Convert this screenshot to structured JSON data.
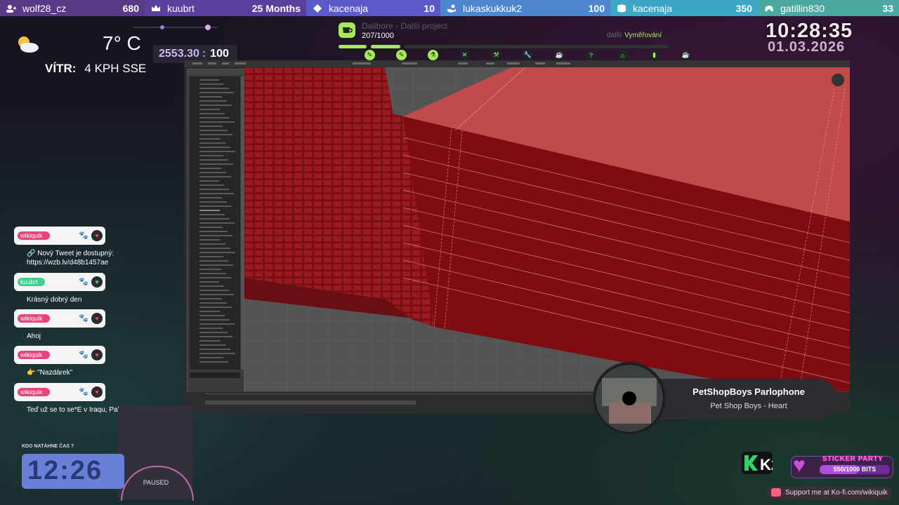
{
  "top_bar": [
    {
      "icon": "user-plus-icon",
      "name": "wolf28_cz",
      "value": "680",
      "bg": "#5a3a86"
    },
    {
      "icon": "crown-icon",
      "name": "kuubrt",
      "value": "25 Months",
      "bg": "#5b3f9e"
    },
    {
      "icon": "diamond-icon",
      "name": "kacenaja",
      "value": "10",
      "bg": "#5c5ac8"
    },
    {
      "icon": "hand-icon",
      "name": "lukaskukkuk2",
      "value": "100",
      "bg": "#4d86cf"
    },
    {
      "icon": "coins-icon",
      "name": "kacenaja",
      "value": "350",
      "bg": "#3da6c7"
    },
    {
      "icon": "gamepad-icon",
      "name": "gatillin830",
      "value": "33",
      "bg": "#4ca8a0"
    }
  ],
  "weather": {
    "icon": "partly-cloudy-icon",
    "temperature": "7° C",
    "wind_label": "VÍTR:",
    "wind_value": "4 KPH SSE"
  },
  "counter": {
    "value": "2553.30",
    "separator": ":",
    "max": "100"
  },
  "clock": {
    "time": "10:28:35",
    "date": "01.03.2026"
  },
  "goal": {
    "title": "Dalibore - Další project",
    "count": "207/1000",
    "progress": 0.207,
    "next_label": "další",
    "next_value": "Vyměřování",
    "colors": {
      "accent": "#a8e85c"
    },
    "milestones": [
      "pencil-icon",
      "pencil-icon",
      "flask-icon",
      "close-icon",
      "hammer-icon",
      "wrench-icon",
      "cup-icon",
      "help-icon",
      "home-icon",
      "bookmark-icon",
      "cup-icon"
    ]
  },
  "chat": [
    {
      "user": "wikiquik",
      "tag_color": "#e8437b",
      "badge": "paw-icon",
      "lines": [
        "🔗 Nový Tweet je dostupný:",
        "https://wzb.lv/d48b1457ae"
      ]
    },
    {
      "user": "kuubrt",
      "tag_color": "#3fcf8e",
      "badge": "paw-icon",
      "lines": [
        "Krásný dobrý den"
      ]
    },
    {
      "user": "wikiquik",
      "tag_color": "#e8437b",
      "badge": "paw-icon",
      "lines": [
        "Ahoj"
      ]
    },
    {
      "user": "wikiquik",
      "tag_color": "#e8437b",
      "badge": "paw-icon",
      "lines": [
        "👉 \"Nazdárek\""
      ]
    },
    {
      "user": "wikiquik",
      "tag_color": "#e8437b",
      "badge": "paw-icon",
      "lines": [
        "Teď už se to se*E v Iraqu, Pakistanu"
      ]
    }
  ],
  "bottom_left": {
    "kdo_label": "KDO NATÁHNE ČAS ?",
    "kdo_time": "12:26",
    "paused": "PAUSED"
  },
  "music": {
    "title": "PetShopBoys Parlophone",
    "subtitle": "Pet Shop Boys - Heart"
  },
  "sticker": {
    "title": "STICKER PARTY",
    "progress_text": "550/1000 BITS",
    "progress": 0.55
  },
  "kofi": {
    "text": "Support me at Ko-fi.com/wikiquik"
  },
  "k2": {
    "label": "K2"
  }
}
